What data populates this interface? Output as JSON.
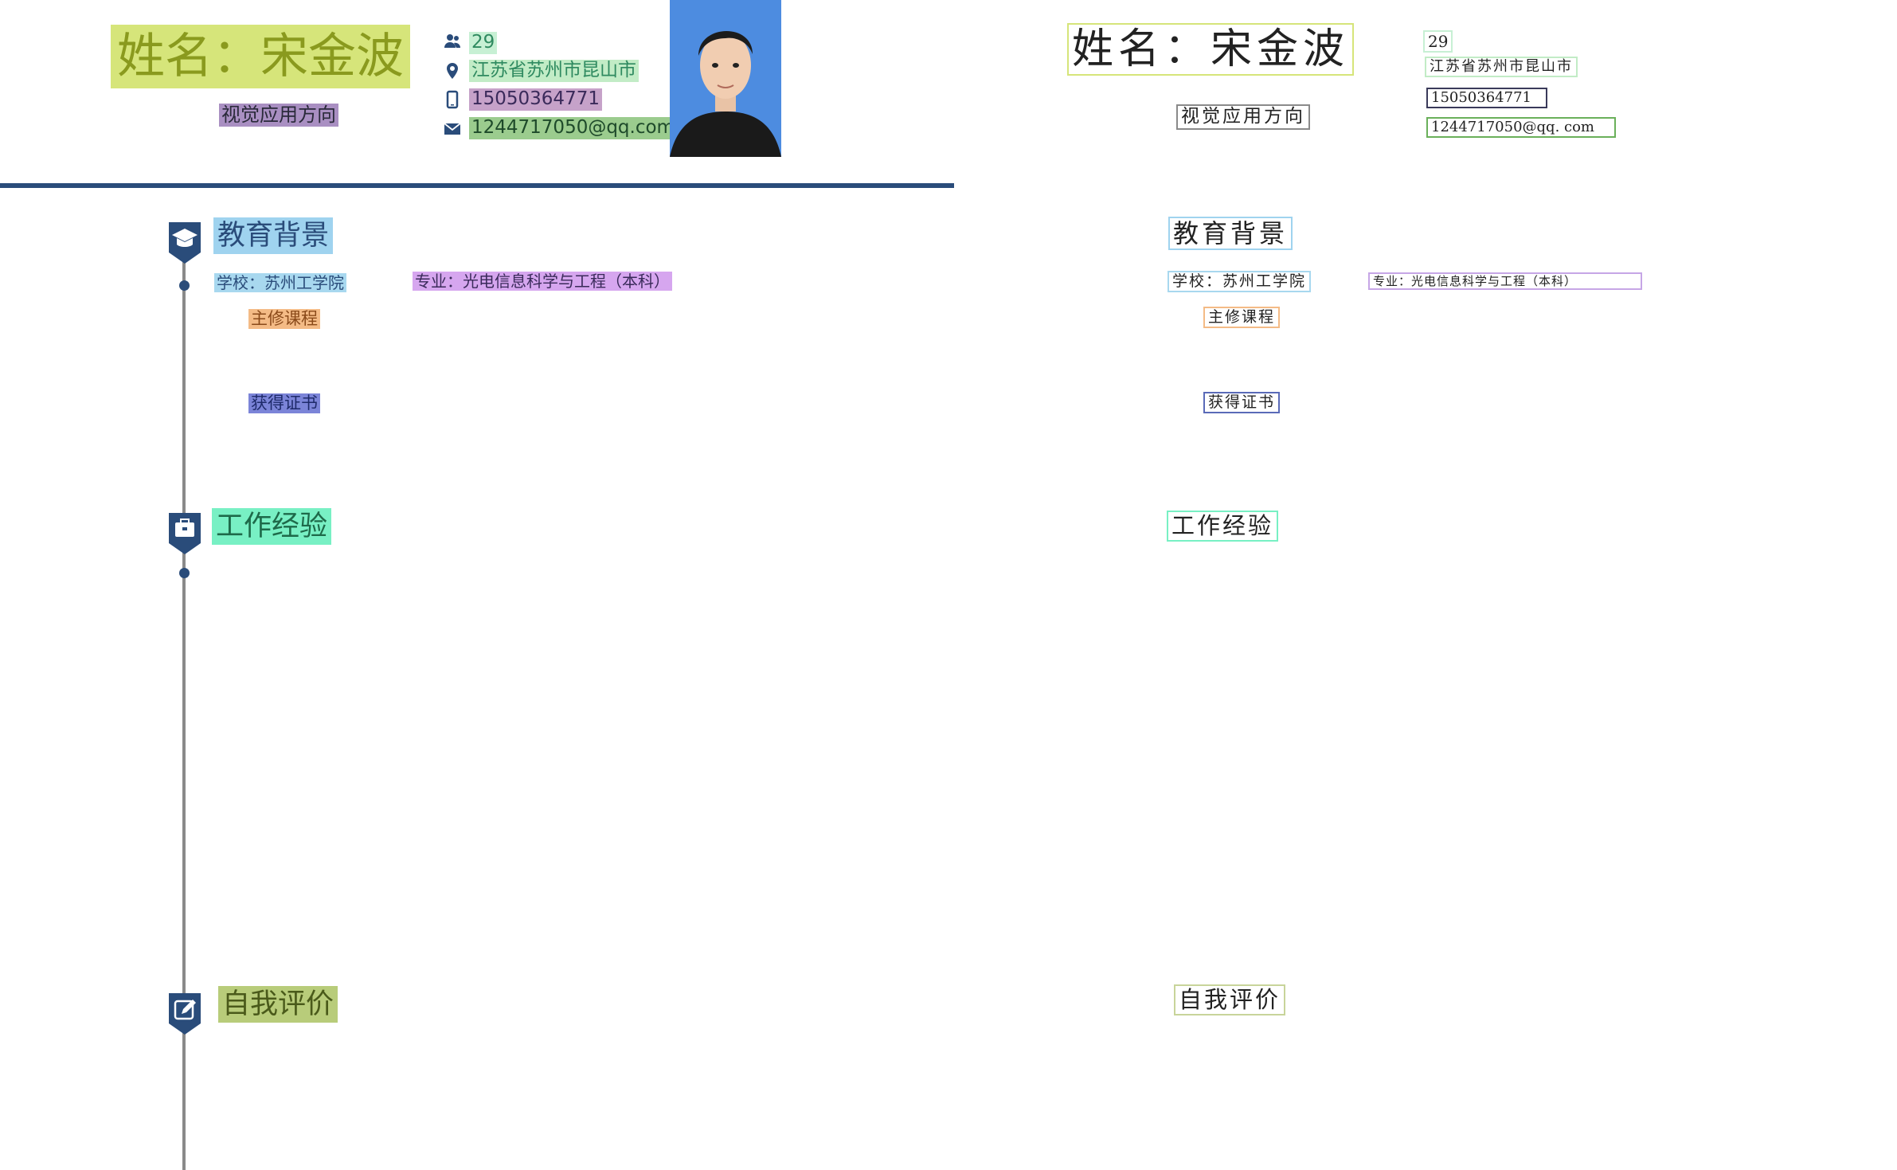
{
  "resume": {
    "name": "姓名：宋金波",
    "job_title": "视觉应用方向",
    "info": {
      "age": "29",
      "location": "江苏省苏州市昆山市",
      "phone": "15050364771",
      "email": "1244717050@qq.com",
      "email_raw": "1244717050@qq. com"
    },
    "sections": {
      "education": {
        "title": "教育背景",
        "school": "学校：苏州工学院",
        "major": "专业：光电信息科学与工程（本科）",
        "courses_label": "主修课程",
        "certs_label": "获得证书"
      },
      "work": {
        "title": "工作经验"
      },
      "self_eval": {
        "title": "自我评价"
      }
    }
  },
  "colors": {
    "accent": "#2a4c7a",
    "name_bg": "#d6e57a",
    "title_bg": "#a98fc2",
    "age_bg": "#c7f0d4",
    "location_bg": "#c2ecc6",
    "phone_bg": "#c6a2c9",
    "email_bg": "#9bcc8e",
    "education_bg": "#9fd3ef",
    "school_bg": "#a8d8ef",
    "major_bg": "#d6a6ef",
    "courses_bg": "#f4bb86",
    "certs_bg": "#7b84d8",
    "work_bg": "#78f0c4",
    "self_eval_bg": "#b8cc7a"
  },
  "icons": [
    "user-group-icon",
    "location-pin-icon",
    "phone-icon",
    "mail-icon",
    "graduation-cap-icon",
    "briefcase-icon",
    "edit-icon"
  ]
}
